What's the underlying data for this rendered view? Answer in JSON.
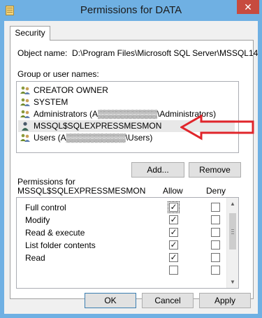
{
  "window": {
    "title": "Permissions for DATA",
    "close_label": "✕"
  },
  "tabs": [
    {
      "label": "Security"
    }
  ],
  "object": {
    "label": "Object name:",
    "path": "D:\\Program Files\\Microsoft SQL Server\\MSSQL14"
  },
  "users": {
    "label": "Group or user names:",
    "items": [
      {
        "label": "CREATOR OWNER"
      },
      {
        "label": "SYSTEM"
      },
      {
        "label": "Administrators (A▒▒▒▒▒▒▒▒▒▒\\Administrators)"
      },
      {
        "label": "MSSQL$SQLEXPRESSMESMON"
      },
      {
        "label": "Users (A▒▒▒▒▒▒▒▒▒▒\\Users)"
      }
    ]
  },
  "buttons": {
    "add": "Add...",
    "remove": "Remove",
    "ok": "OK",
    "cancel": "Cancel",
    "apply": "Apply"
  },
  "permissions": {
    "label_line1": "Permissions for",
    "label_line2": "MSSQL$SQLEXPRESSMESMON",
    "allow_header": "Allow",
    "deny_header": "Deny",
    "rows": [
      {
        "label": "Full control",
        "allow": true,
        "deny": false
      },
      {
        "label": "Modify",
        "allow": true,
        "deny": false
      },
      {
        "label": "Read & execute",
        "allow": true,
        "deny": false
      },
      {
        "label": "List folder contents",
        "allow": true,
        "deny": false
      },
      {
        "label": "Read",
        "allow": true,
        "deny": false
      }
    ]
  },
  "colors": {
    "titlebar": "#6fb0e3",
    "close": "#c74b3f",
    "arrow": "#e0252b"
  }
}
